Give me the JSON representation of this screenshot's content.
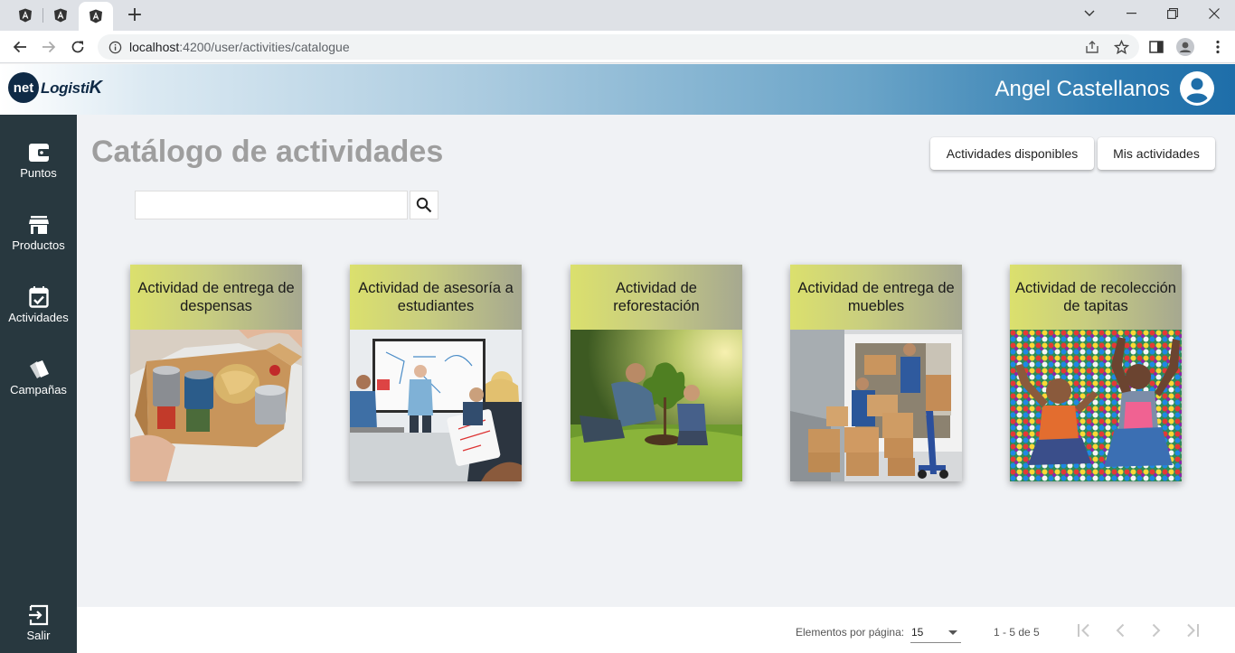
{
  "browser": {
    "tabs": [
      {
        "icon": "angular-icon",
        "active": false
      },
      {
        "icon": "angular-icon",
        "active": false
      },
      {
        "icon": "angular-icon",
        "active": true
      }
    ],
    "new_tab_label": "+",
    "url_host": "localhost",
    "url_path": ":4200/user/activities/catalogue"
  },
  "header": {
    "brand_net": "net",
    "brand_name": "Logisti",
    "brand_k": "K",
    "user_name": "Angel Castellanos"
  },
  "sidebar": {
    "items": [
      {
        "label": "Puntos",
        "icon": "wallet-icon"
      },
      {
        "label": "Productos",
        "icon": "store-icon"
      },
      {
        "label": "Actividades",
        "icon": "calendar-check-icon"
      },
      {
        "label": "Campañas",
        "icon": "tickets-icon"
      }
    ],
    "logout_label": "Salir"
  },
  "main": {
    "title": "Catálogo de actividades",
    "available_button": "Actividades disponibles",
    "my_button": "Mis actividades",
    "search_value": ""
  },
  "cards": [
    {
      "title": "Actividad de entrega de despensas",
      "image": "food-box-photo"
    },
    {
      "title": "Actividad de asesoría a estudiantes",
      "image": "classroom-photo"
    },
    {
      "title": "Actividad de reforestación",
      "image": "tree-planting-photo"
    },
    {
      "title": "Actividad de entrega de muebles",
      "image": "moving-boxes-photo"
    },
    {
      "title": "Actividad de recolección de tapitas",
      "image": "bottle-caps-photo"
    }
  ],
  "paginator": {
    "items_per_page_label": "Elementos por página:",
    "items_per_page_value": "15",
    "range_label": "1 - 5 de 5"
  }
}
